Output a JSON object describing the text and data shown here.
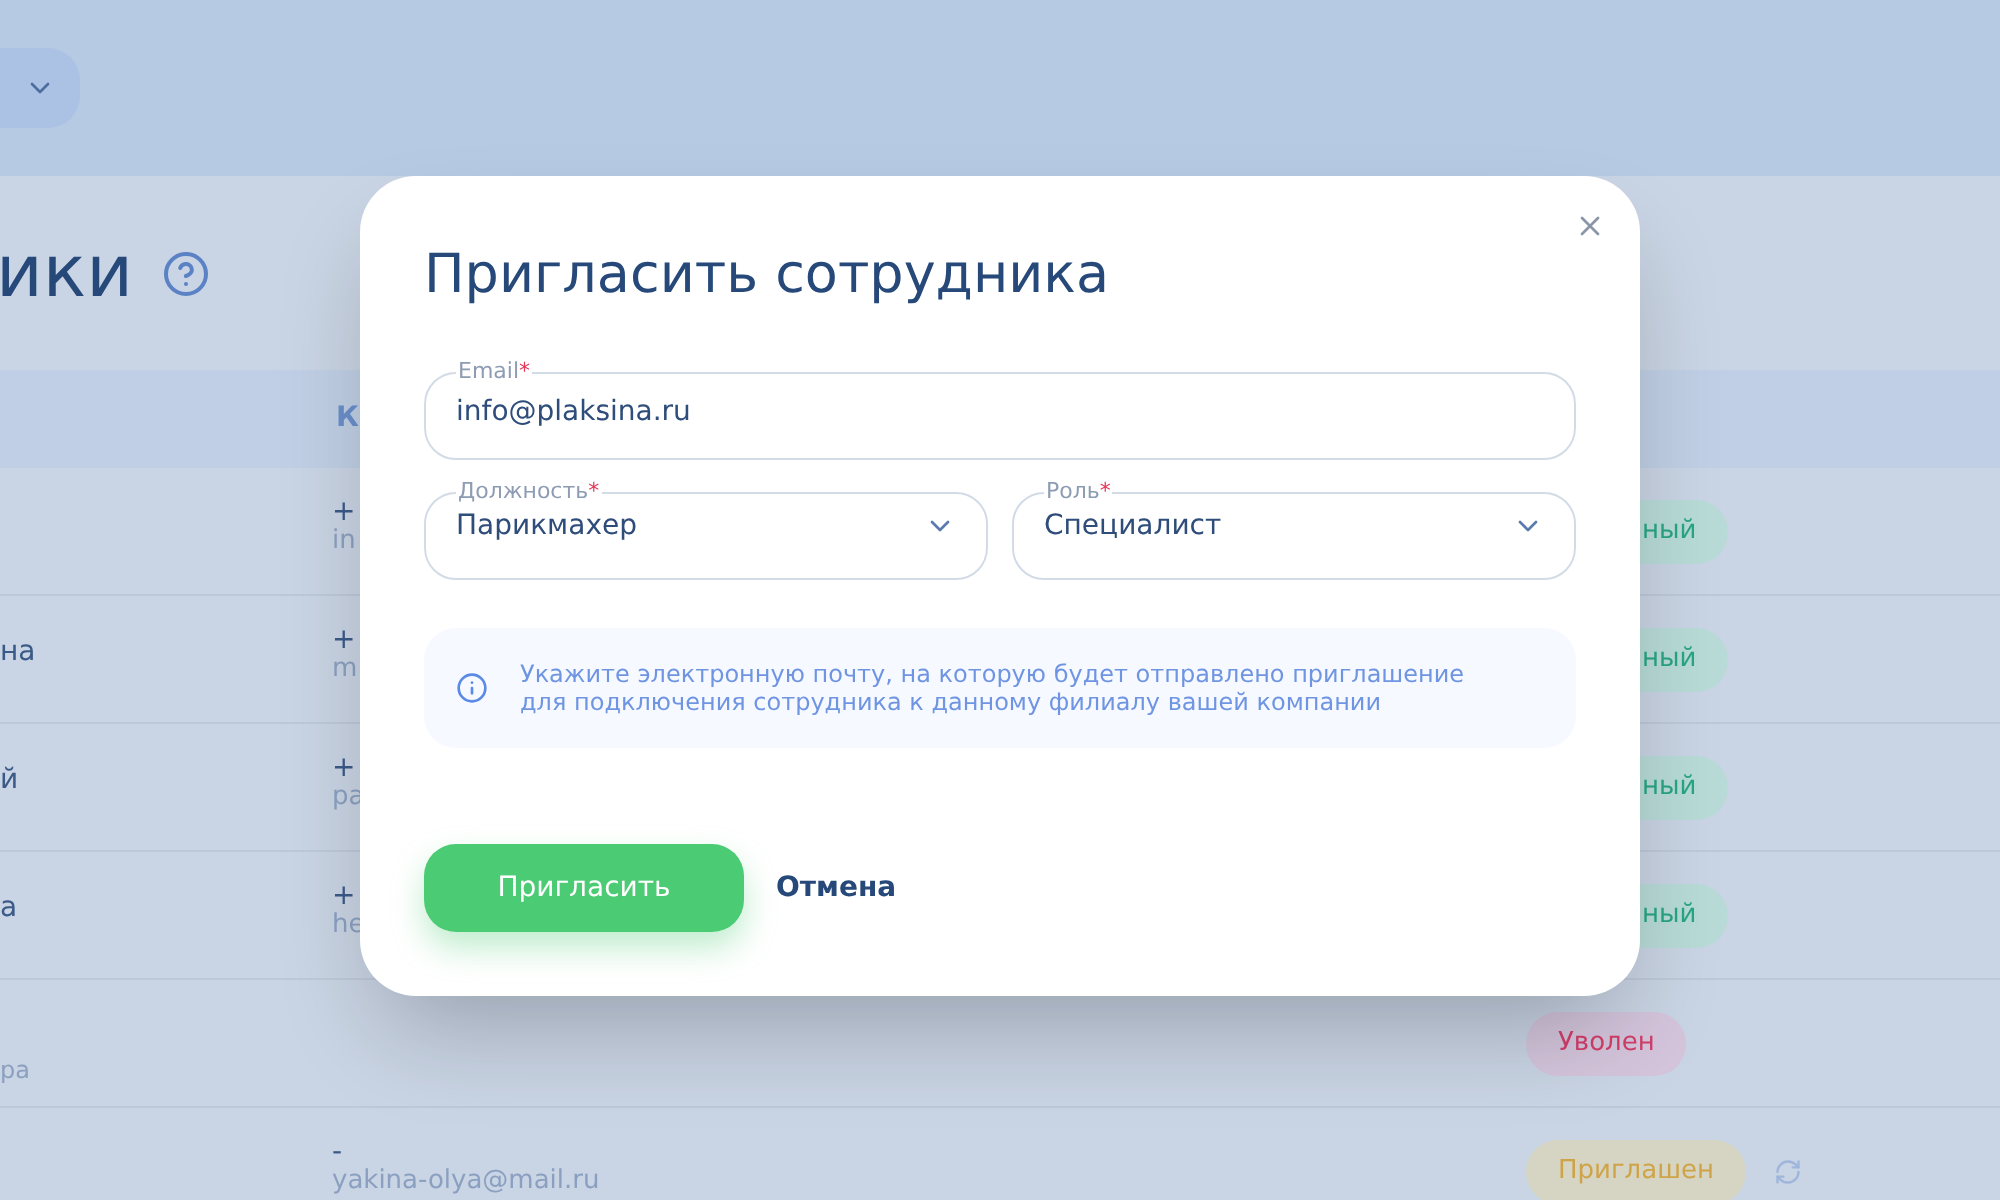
{
  "page": {
    "title": "ики"
  },
  "table": {
    "header": "К",
    "rows": [
      {
        "name": "",
        "name_sub": "",
        "contact": "+",
        "contact_sub": "in",
        "status": "ный",
        "kind": "active",
        "refresh": false
      },
      {
        "name": "на",
        "name_sub": "",
        "contact": "+",
        "contact_sub": "m",
        "status": "ный",
        "kind": "active",
        "refresh": false
      },
      {
        "name": "й",
        "name_sub": "",
        "contact": "+",
        "contact_sub": "pa",
        "status": "ный",
        "kind": "active",
        "refresh": false
      },
      {
        "name": "а",
        "name_sub": "",
        "contact": "+",
        "contact_sub": "he",
        "status": "ный",
        "kind": "active",
        "refresh": false
      },
      {
        "name": "",
        "name_sub": "ра",
        "contact": "",
        "contact_sub": "",
        "status": "Уволен",
        "kind": "fired",
        "refresh": false
      },
      {
        "name": "",
        "name_sub": "",
        "contact": "-",
        "contact_sub": "yakina-olya@mail.ru",
        "status": "Приглашен",
        "kind": "invited",
        "refresh": true
      }
    ]
  },
  "modal": {
    "title": "Пригласить сотрудника",
    "email": {
      "label": "Email",
      "required": true,
      "mark": "*",
      "value": "info@plaksina.ru"
    },
    "selects": [
      {
        "label": "Должность",
        "required": true,
        "mark": "*",
        "value": "Парикмахер"
      },
      {
        "label": "Роль",
        "required": true,
        "mark": "*",
        "value": "Специалист"
      }
    ],
    "info": [
      "Укажите электронную почту, на которую будет отправлено приглашение",
      "для подключения сотрудника к данному филиалу вашей компании"
    ],
    "buttons": [
      {
        "label": "Пригласить",
        "kind": "primary"
      },
      {
        "label": "Отмена",
        "kind": "link"
      }
    ]
  }
}
